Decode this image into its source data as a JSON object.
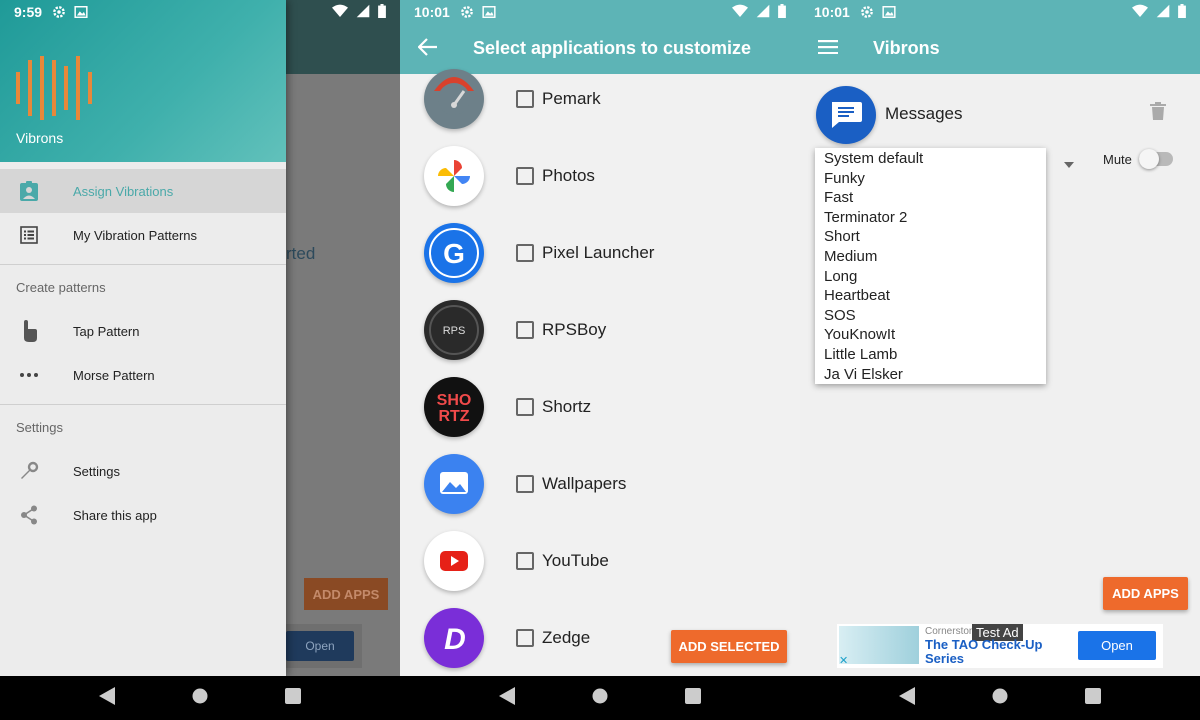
{
  "screen1": {
    "status_time": "9:59",
    "drawer": {
      "app_name": "Vibrons",
      "items": [
        {
          "label": "Assign Vibrations",
          "icon": "assign-vibrations-icon",
          "active": true
        },
        {
          "label": "My Vibration Patterns",
          "icon": "list-icon",
          "active": false
        }
      ],
      "create_section": "Create patterns",
      "create_items": [
        {
          "label": "Tap Pattern",
          "icon": "tap-icon"
        },
        {
          "label": "Morse Pattern",
          "icon": "dots-icon"
        }
      ],
      "settings_section": "Settings",
      "settings_items": [
        {
          "label": "Settings",
          "icon": "wrench-icon"
        },
        {
          "label": "Share this app",
          "icon": "share-icon"
        }
      ]
    },
    "background": {
      "text_fragment": "rted",
      "add_apps": "ADD APPS",
      "open": "Open"
    }
  },
  "screen2": {
    "status_time": "10:01",
    "title": "Select applications to customize",
    "apps": [
      {
        "label": "Pemark",
        "icon": "pemark-icon"
      },
      {
        "label": "Photos",
        "icon": "photos-icon"
      },
      {
        "label": "Pixel Launcher",
        "icon": "pixel-launcher-icon"
      },
      {
        "label": "RPSBoy",
        "icon": "rpsboy-icon"
      },
      {
        "label": "Shortz",
        "icon": "shortz-icon"
      },
      {
        "label": "Wallpapers",
        "icon": "wallpapers-icon"
      },
      {
        "label": "YouTube",
        "icon": "youtube-icon"
      },
      {
        "label": "Zedge",
        "icon": "zedge-icon"
      }
    ],
    "add_selected": "ADD SELECTED"
  },
  "screen3": {
    "status_time": "10:01",
    "title": "Vibrons",
    "app_label": "Messages",
    "mute_label": "Mute",
    "mute_on": false,
    "dropdown_options": [
      "System default",
      "Funky",
      "Fast",
      "Terminator 2",
      "Short",
      "Medium",
      "Long",
      "Heartbeat",
      "SOS",
      "YouKnowIt",
      "Little Lamb",
      "Ja Vi Elsker"
    ],
    "add_apps": "ADD APPS",
    "ad": {
      "tag": "Test Ad",
      "source": "Cornerstone",
      "title": "The TAO Check-Up Series",
      "open": "Open"
    }
  },
  "colors": {
    "teal": "#5db4b6",
    "orange": "#ee6a2c",
    "active_text": "#4aa9a9",
    "ad_button": "#1a73e8"
  }
}
